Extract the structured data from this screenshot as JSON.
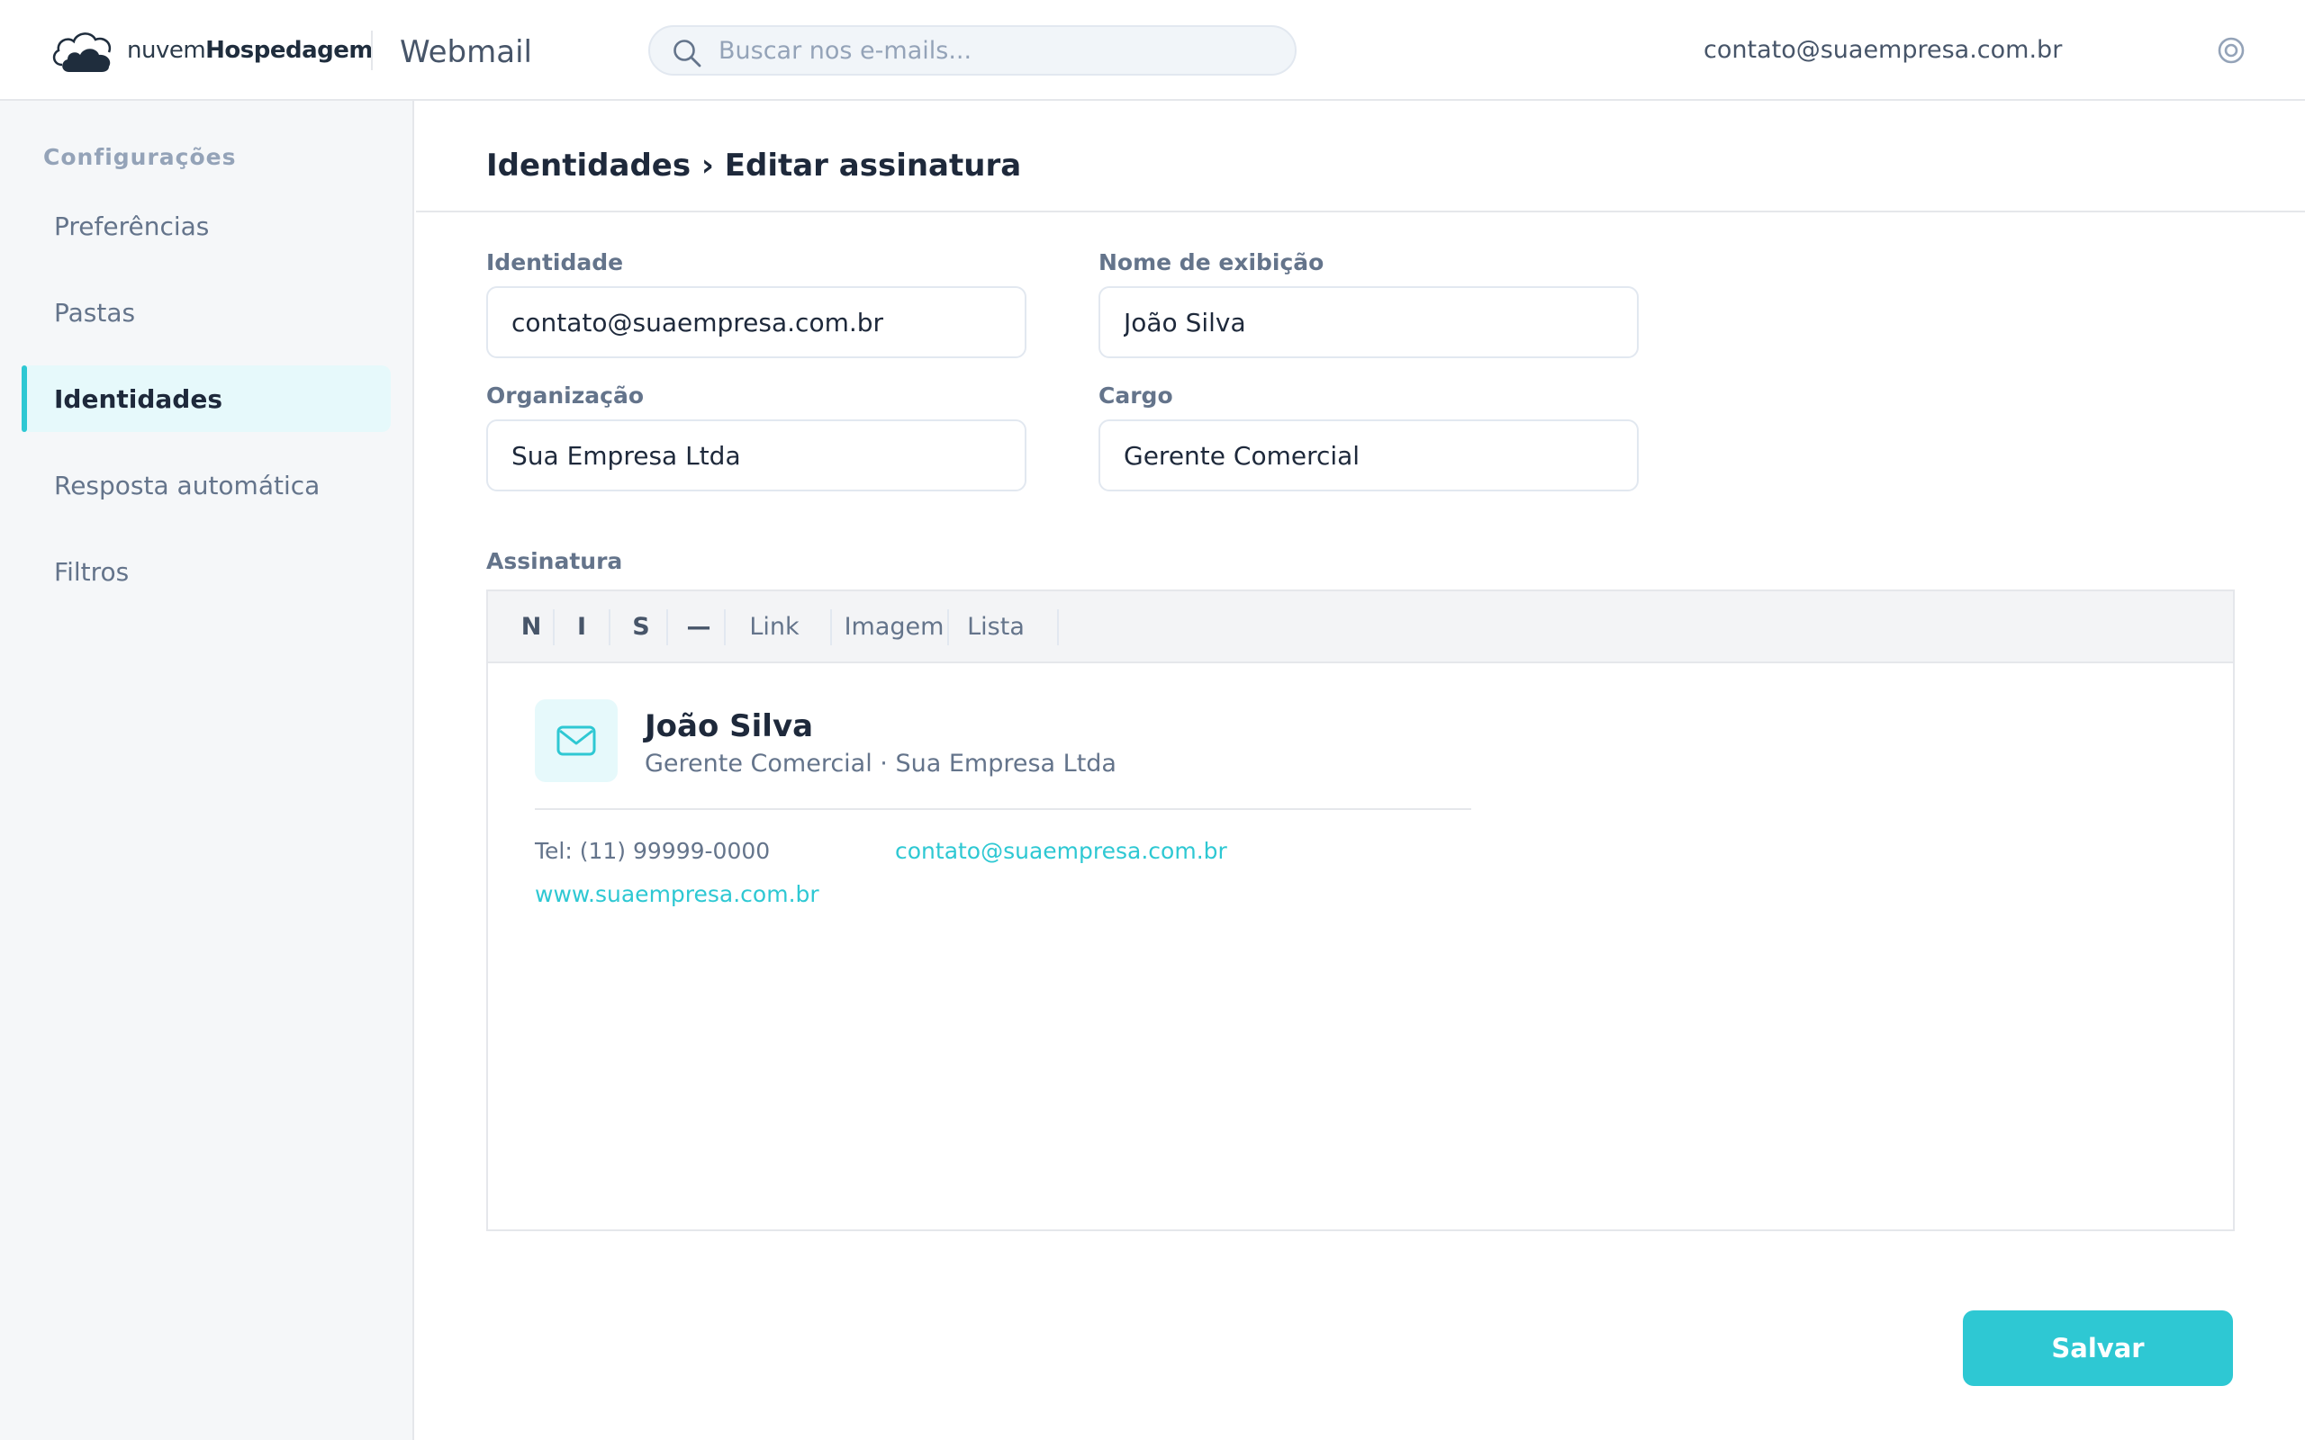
{
  "brand": {
    "name_light": "nuvem",
    "name_bold": "Hospedagem",
    "icon": "cloud-logo-icon"
  },
  "header": {
    "app_name": "Webmail",
    "search_placeholder": "Buscar nos e-mails...",
    "account_email": "contato@suaempresa.com.br",
    "settings_icon": "settings-icon"
  },
  "sidebar": {
    "heading": "Configurações",
    "items": [
      {
        "label": "Preferências",
        "active": false
      },
      {
        "label": "Pastas",
        "active": false
      },
      {
        "label": "Identidades",
        "active": true
      },
      {
        "label": "Resposta automática",
        "active": false
      },
      {
        "label": "Filtros",
        "active": false
      }
    ]
  },
  "page": {
    "title": "Identidades › Editar assinatura"
  },
  "form": {
    "identity": {
      "label": "Identidade",
      "value": "contato@suaempresa.com.br"
    },
    "display_name": {
      "label": "Nome de exibição",
      "value": "João Silva"
    },
    "organization": {
      "label": "Organização",
      "value": "Sua Empresa Ltda"
    },
    "role": {
      "label": "Cargo",
      "value": "Gerente Comercial"
    },
    "signature_label": "Assinatura"
  },
  "toolbar": {
    "bold": "N",
    "italic": "I",
    "strike": "S",
    "rule": "—",
    "link": "Link",
    "image": "Imagem",
    "list": "Lista"
  },
  "signature": {
    "icon": "mail-icon",
    "name": "João Silva",
    "subtitle": "Gerente Comercial · Sua Empresa Ltda",
    "phone": "Tel: (11) 99999-0000",
    "email": "contato@suaempresa.com.br",
    "website": "www.suaempresa.com.br"
  },
  "actions": {
    "save": "Salvar"
  },
  "colors": {
    "accent": "#2ec8d3",
    "text_dark": "#1e293b",
    "text_muted": "#64748b",
    "sidebar_bg": "#f5f7f9"
  }
}
